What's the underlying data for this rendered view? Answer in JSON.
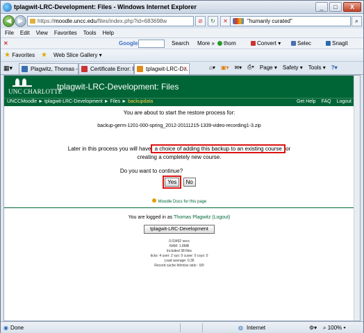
{
  "window": {
    "title": "tplagwit-LRC-Development: Files - Windows Internet Explorer",
    "buttons": {
      "minimize": "_",
      "maximize": "□",
      "close": "X"
    }
  },
  "address": {
    "url_prefix": "https://",
    "url_domain": "moodle.uncc.edu",
    "url_path": "/files/index.php?id=683698w",
    "search_value": "\"humanly curated\""
  },
  "menu": [
    "File",
    "Edit",
    "View",
    "Favorites",
    "Tools",
    "Help"
  ],
  "google_toolbar": {
    "label": "Google",
    "search_btn": "Search",
    "more": "More »",
    "thom": "thom",
    "convert": "Convert",
    "select": "Selec",
    "snagit": "Snagit"
  },
  "favorites": {
    "favorites_label": "Favorites",
    "webslice_label": "Web Slice Gallery"
  },
  "tabs": [
    {
      "label": "Plagwitz, Thomas -..."
    },
    {
      "label": "Certificate Error: N..."
    },
    {
      "label": "tplagwit-LRC-D..."
    }
  ],
  "commands": {
    "page": "Page",
    "safety": "Safety",
    "tools": "Tools"
  },
  "moodle": {
    "university": "UNC CHARLOTTE",
    "course_title": "tplagwit-LRC-Development: Files",
    "breadcrumbs": [
      "UNCCMoodle",
      "tplagwit-LRC-Development",
      "Files"
    ],
    "current_crumb": "backupdata",
    "top_links": [
      "Get Help",
      "FAQ",
      "Logout"
    ],
    "intro": "You are about to start the restore process for:",
    "filename": "backup-germ-1201-000-spring_2012-20111215-1339-video-recording1-3.zip",
    "later_pre": "Later in this process you will have",
    "later_highlight": " a choice of adding this backup to an existing course ",
    "later_post": "or",
    "later_line2": "creating a completely new course.",
    "question": "Do you want to continue?",
    "yes": "Yes",
    "no": "No",
    "docs_link": "Moodle Docs for this page",
    "logged_pre": "You are logged in as ",
    "logged_user": "Thomas Plagwitz",
    "logged_out": " (Logout)",
    "course_button": "tplagwit-LRC-Development",
    "perf": [
      "0.03492 secs",
      "RAM: 1.8MB",
      "Included 38 files",
      "ticks: 4 user: 2 sys: 0 cuser: 0 csys: 0",
      "Load average: 0.36",
      "Record cache hit/miss ratio : 0/0"
    ]
  },
  "status": {
    "done": "Done",
    "zone": "Internet",
    "zoom": "100%"
  }
}
